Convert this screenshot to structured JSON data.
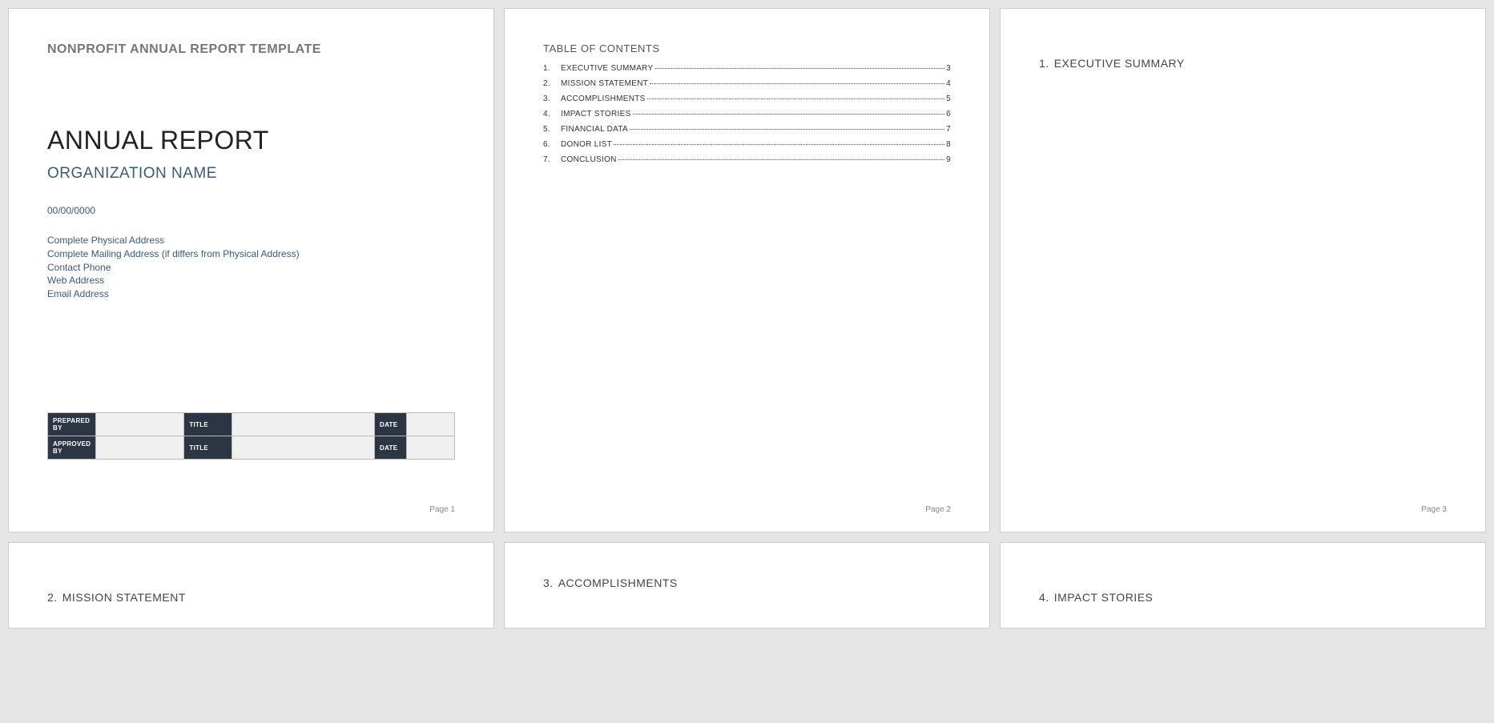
{
  "page1": {
    "template_header": "NONPROFIT ANNUAL REPORT TEMPLATE",
    "title": "ANNUAL REPORT",
    "org_name": "ORGANIZATION NAME",
    "date": "00/00/0000",
    "address_lines": [
      "Complete Physical Address",
      "Complete Mailing Address (if differs from Physical Address)",
      "Contact Phone",
      "Web Address",
      "Email Address"
    ],
    "approval": {
      "rows": [
        {
          "label1": "PREPARED BY",
          "val1": "",
          "label2": "TITLE",
          "val2": "",
          "label3": "DATE",
          "val3": ""
        },
        {
          "label1": "APPROVED BY",
          "val1": "",
          "label2": "TITLE",
          "val2": "",
          "label3": "DATE",
          "val3": ""
        }
      ]
    },
    "page_label": "Page 1"
  },
  "page2": {
    "toc_title": "TABLE OF CONTENTS",
    "items": [
      {
        "label": "EXECUTIVE SUMMARY",
        "page": "3"
      },
      {
        "label": "MISSION STATEMENT",
        "page": "4"
      },
      {
        "label": "ACCOMPLISHMENTS",
        "page": "5"
      },
      {
        "label": "IMPACT STORIES",
        "page": "6"
      },
      {
        "label": "FINANCIAL DATA",
        "page": "7"
      },
      {
        "label": "DONOR LIST",
        "page": "8"
      },
      {
        "label": "CONCLUSION",
        "page": "9"
      }
    ],
    "page_label": "Page 2"
  },
  "page3": {
    "num": "1.",
    "heading": "EXECUTIVE SUMMARY",
    "page_label": "Page 3"
  },
  "page4": {
    "num": "2.",
    "heading": "MISSION STATEMENT"
  },
  "page5": {
    "num": "3.",
    "heading": "ACCOMPLISHMENTS"
  },
  "page6": {
    "num": "4.",
    "heading": "IMPACT STORIES"
  }
}
